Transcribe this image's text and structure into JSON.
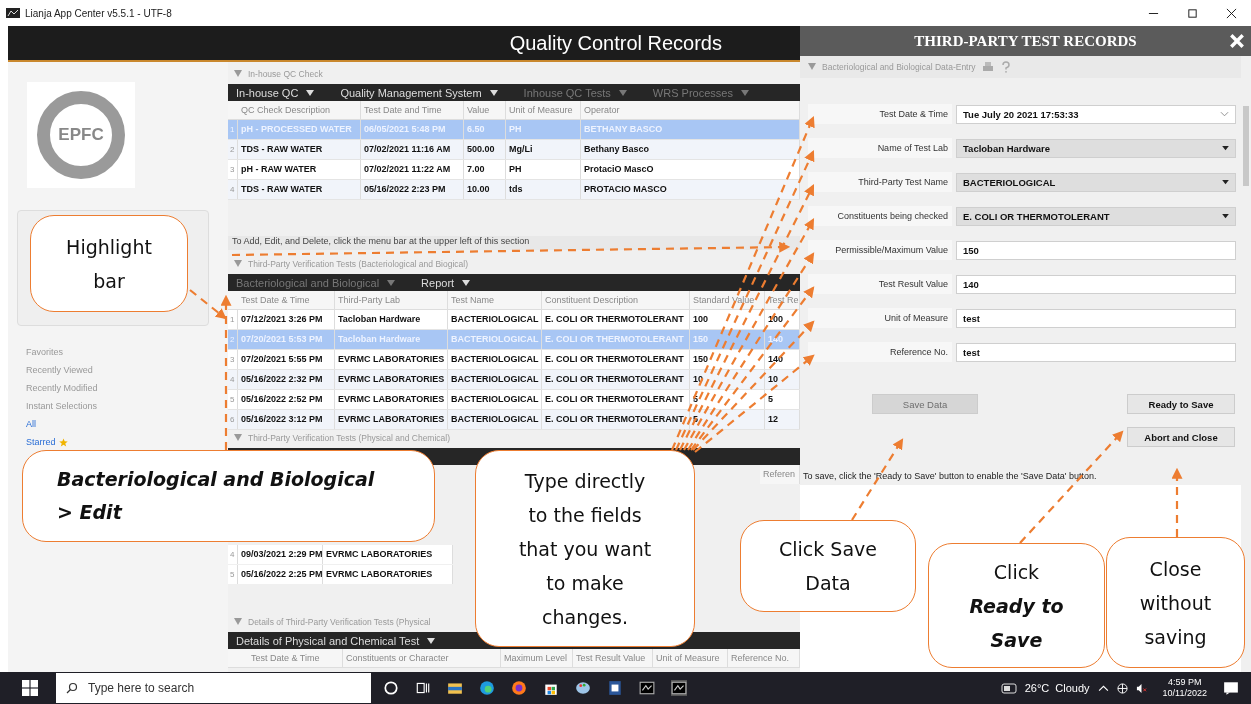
{
  "window": {
    "title": "Lianja App Center v5.5.1 - UTF-8"
  },
  "app_header": {
    "title": "Quality Control Records"
  },
  "sidebar": {
    "logo_text": "EPFC",
    "nav": [
      {
        "label": "Favorites",
        "kind": "plain"
      },
      {
        "label": "Recently Viewed",
        "kind": "plain"
      },
      {
        "label": "Recently Modified",
        "kind": "plain"
      },
      {
        "label": "Instant Selections",
        "kind": "plain"
      },
      {
        "label": "All",
        "kind": "link"
      },
      {
        "label": "Starred",
        "kind": "link-star"
      }
    ]
  },
  "sections": [
    {
      "title": "In-house QC Check",
      "menu": [
        {
          "label": "In-house QC",
          "dim": false
        },
        {
          "label": "Quality Management System",
          "dim": false
        },
        {
          "label": "Inhouse QC Tests",
          "dim": true
        },
        {
          "label": "WRS Processes",
          "dim": true
        }
      ],
      "table": {
        "columns": [
          "QC Check Description",
          "Test Date and Time",
          "Value",
          "Unit of Measure",
          "Operator"
        ],
        "rows": [
          {
            "num": "1",
            "selected": true,
            "cells": [
              "pH - PROCESSED WATER",
              "06/05/2021 5:48 PM",
              "6.50",
              "PH",
              "BETHANY BASCO"
            ]
          },
          {
            "num": "2",
            "selected": false,
            "cells": [
              "TDS - RAW WATER",
              "07/02/2021 11:16 AM",
              "500.00",
              "Mg/Li",
              "Bethany Basco"
            ]
          },
          {
            "num": "3",
            "selected": false,
            "cells": [
              "pH - RAW WATER",
              "07/02/2021 11:22 AM",
              "7.00",
              "PH",
              "ProtaciO MascO"
            ]
          },
          {
            "num": "4",
            "selected": false,
            "cells": [
              "TDS - RAW WATER",
              "05/16/2022 2:23 PM",
              "10.00",
              "tds",
              "PROTACIO MASCO"
            ]
          }
        ]
      },
      "hint": "To Add, Edit, and Delete, click the menu bar at the upper left of this section"
    },
    {
      "title": "Third-Party Verification Tests (Bacteriological and Biogical)",
      "menu": [
        {
          "label": "Bacteriological and Biological",
          "dim": true
        },
        {
          "label": "Report",
          "dim": false
        }
      ],
      "table": {
        "columns": [
          "Test Date & Time",
          "Third-Party Lab",
          "Test Name",
          "Constituent Description",
          "Standard Value",
          "Test Re"
        ],
        "rows": [
          {
            "num": "1",
            "selected": false,
            "cells": [
              "07/12/2021 3:26 PM",
              "Tacloban Hardware",
              "BACTERIOLOGICAL",
              "E. COLI OR THERMOTOLERANT",
              "100",
              "100"
            ]
          },
          {
            "num": "2",
            "selected": true,
            "cells": [
              "07/20/2021 5:53 PM",
              "Tacloban Hardware",
              "BACTERIOLOGICAL",
              "E. COLI OR THERMOTOLERANT",
              "150",
              "140"
            ]
          },
          {
            "num": "3",
            "selected": false,
            "cells": [
              "07/20/2021 5:55 PM",
              "EVRMC LABORATORIES",
              "BACTERIOLOGICAL",
              "E. COLI OR THERMOTOLERANT",
              "150",
              "140"
            ]
          },
          {
            "num": "4",
            "selected": false,
            "cells": [
              "05/16/2022 2:32 PM",
              "EVRMC LABORATORIES",
              "BACTERIOLOGICAL",
              "E. COLI OR THERMOTOLERANT",
              "10",
              "10"
            ]
          },
          {
            "num": "5",
            "selected": false,
            "cells": [
              "05/16/2022 2:52 PM",
              "EVRMC LABORATORIES",
              "BACTERIOLOGICAL",
              "E. COLI OR THERMOTOLERANT",
              "5",
              "5"
            ]
          },
          {
            "num": "6",
            "selected": false,
            "cells": [
              "05/16/2022 3:12 PM",
              "EVRMC LABORATORIES",
              "BACTERIOLOGICAL",
              "E. COLI OR THERMOTOLERANT",
              "5",
              "12"
            ]
          }
        ]
      }
    },
    {
      "title": "Third-Party Verification Tests (Physical and Chemical)",
      "table": {
        "columns": [
          "",
          "",
          "",
          "",
          "",
          "Referen"
        ],
        "rows": [
          {
            "num": "4",
            "selected": false,
            "cells": [
              "09/03/2021 2:29 PM",
              "EVRMC LABORATORIES"
            ]
          },
          {
            "num": "5",
            "selected": false,
            "cells": [
              "05/16/2022 2:25 PM",
              "EVRMC LABORATORIES"
            ]
          }
        ]
      }
    },
    {
      "title": "Details of Third-Party Verification Tests (Physical",
      "menu": [
        {
          "label": "Details of Physical and Chemical Test",
          "dim": false
        }
      ],
      "table": {
        "columns": [
          "Test Date & Time",
          "Constituents or Character",
          "Maximum Level",
          "Test Result Value",
          "Unit of Measure",
          "Reference No."
        ]
      }
    }
  ],
  "panel": {
    "title": "THIRD-PARTY TEST RECORDS",
    "form": {
      "title": "Bacteriological and Biological Data-Entry",
      "fields": [
        {
          "label": "Test Date & Time",
          "kind": "date",
          "value": "Tue July 20 2021 17:53:33"
        },
        {
          "label": "Name of Test Lab",
          "kind": "select",
          "value": "Tacloban Hardware"
        },
        {
          "label": "Third-Party Test Name",
          "kind": "select",
          "value": "BACTERIOLOGICAL"
        },
        {
          "label": "Constituents being checked",
          "kind": "select",
          "value": "E. COLI OR THERMOTOLERANT"
        },
        {
          "label": "Permissible/Maximum Value",
          "kind": "text",
          "value": "150"
        },
        {
          "label": "Test Result Value",
          "kind": "text",
          "value": "140"
        },
        {
          "label": "Unit of Measure",
          "kind": "text",
          "value": "test"
        },
        {
          "label": "Reference No.",
          "kind": "text",
          "value": "test"
        }
      ],
      "buttons": [
        {
          "label": "Save Data",
          "disabled": true
        },
        {
          "label": "Ready to Save",
          "disabled": false
        },
        {
          "label": "Abort and Close",
          "disabled": false
        }
      ],
      "note": "To save, click the 'Ready to Save' button to enable the 'Save Data' button."
    }
  },
  "callouts": [
    {
      "text": "Highlight\nbar"
    },
    {
      "text": "Bacteriological and Biological\n> Edit"
    },
    {
      "text": "Type directly\nto the fields\nthat you want\nto make\nchanges."
    },
    {
      "text": "Click Save\nData"
    },
    {
      "text": "Click\n**Ready to\nSave**"
    },
    {
      "text": "Close\nwithout\nsaving"
    }
  ],
  "taskbar": {
    "search_placeholder": "Type here to search",
    "weather": "26°C  Cloudy",
    "time": "4:59 PM",
    "date": "10/11/2022"
  }
}
